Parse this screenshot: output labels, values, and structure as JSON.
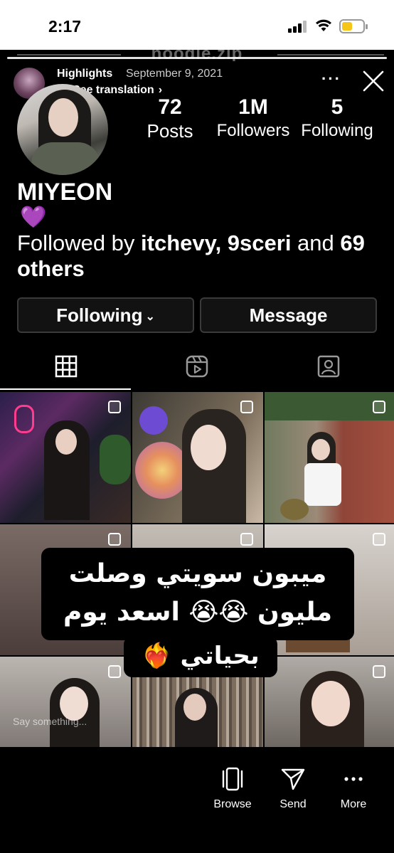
{
  "status_bar": {
    "time": "2:17",
    "battery_color": "#f5c518"
  },
  "story": {
    "profile_cut_text": "noodle.zip",
    "username": "Highlights",
    "date": "September 9, 2021",
    "translate_label": "See translation",
    "translate_chevron": "›",
    "more_label": "···"
  },
  "profile": {
    "stats": [
      {
        "value": "72",
        "label": "Posts"
      },
      {
        "value": "1M",
        "label": "Followers"
      },
      {
        "value": "5",
        "label": "Following"
      }
    ],
    "name": "MIYEON",
    "bio_emoji": "💜",
    "followed_by_prefix": "Followed by ",
    "followed_by_names": "itchevy, 9sceri",
    "followed_by_and": " and ",
    "followed_by_others": "69 others",
    "following_button": "Following",
    "following_chevron": "⌄",
    "message_button": "Message"
  },
  "tabs": [
    "grid",
    "reels",
    "tagged"
  ],
  "caption": {
    "line1": "ميبون سويتي وصلت",
    "line2": "مليون 😭😭 اسعد يوم",
    "line3": "بحياتي ❤️‍🔥"
  },
  "reply_placeholder": "Say something...",
  "bottom_bar": {
    "browse_label": "Browse",
    "send_label": "Send",
    "more_label": "More"
  },
  "colors": {
    "accent_heart": "#9b4de8"
  }
}
